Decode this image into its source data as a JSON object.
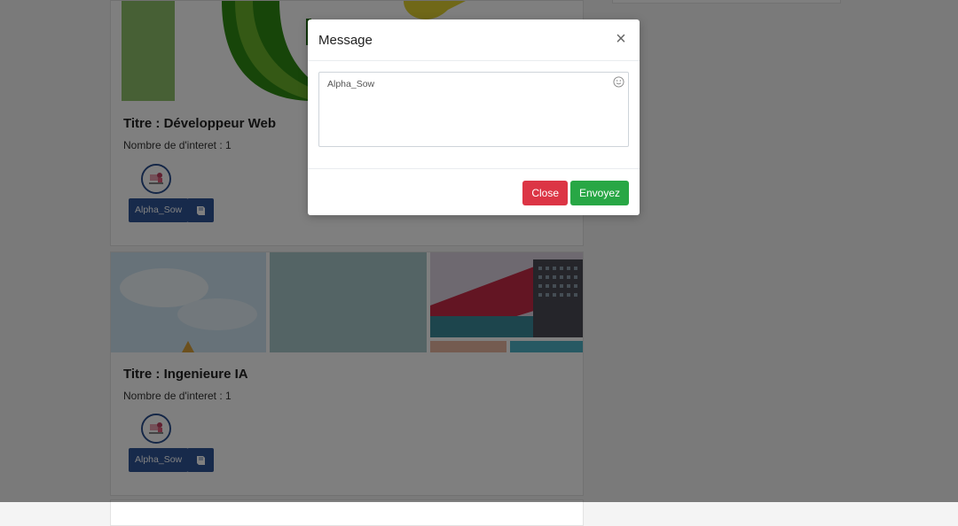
{
  "cards": [
    {
      "title": "Titre : Développeur Web",
      "interest": "Nombre de d'interet : 1",
      "user_label": "Alpha_Sow"
    },
    {
      "title": "Titre : Ingenieure IA",
      "interest": "Nombre de d'interet : 1",
      "user_label": "Alpha_Sow"
    }
  ],
  "modal": {
    "title": "Message",
    "close_symbol": "×",
    "textarea_value": "Alpha_Sow",
    "close_label": "Close",
    "send_label": "Envoyez"
  },
  "colors": {
    "primary": "#2e5597",
    "danger": "#dc3545",
    "success": "#28a745",
    "overlay": "rgba(0,0,0,0.5)"
  },
  "icons": {
    "book": "book-icon",
    "emoji": "smiley-icon",
    "close": "close-icon"
  }
}
